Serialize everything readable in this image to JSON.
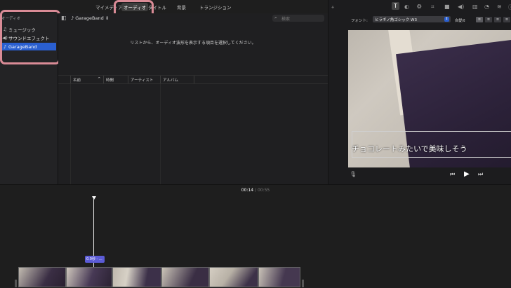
{
  "top_tabs": [
    {
      "label": "マイメディア"
    },
    {
      "label": "オーディオ"
    },
    {
      "label": "タイトル"
    },
    {
      "label": "背景"
    },
    {
      "label": "トランジション"
    }
  ],
  "sidebar": {
    "section_label": "オーディオ",
    "items": [
      {
        "label": "ミュージック",
        "icon": "music-note-icon"
      },
      {
        "label": "サウンドエフェクト",
        "icon": "speaker-icon"
      },
      {
        "label": "GarageBand",
        "icon": "guitar-icon",
        "selected": true
      }
    ]
  },
  "browser": {
    "source_label": "GarageBand",
    "search_placeholder": "検索",
    "empty_message": "リストから、オーディオ波形を表示する項目を選択してください。",
    "columns": [
      "名前",
      "時間",
      "アーティスト",
      "アルバム"
    ]
  },
  "inspector": {
    "font_label": "フォント:",
    "font_value": "ヒラギノ角ゴシック W3",
    "auto_label": "自動"
  },
  "viewer": {
    "caption": "チョコレートみたいで美味しそう"
  },
  "timeline": {
    "current_time": "00:14",
    "separator": "/",
    "total_time": "00:55",
    "title_clip_label": "0.0秒 - ..."
  },
  "colors": {
    "accent": "#2a5fd0",
    "highlight": "#d98b96"
  }
}
